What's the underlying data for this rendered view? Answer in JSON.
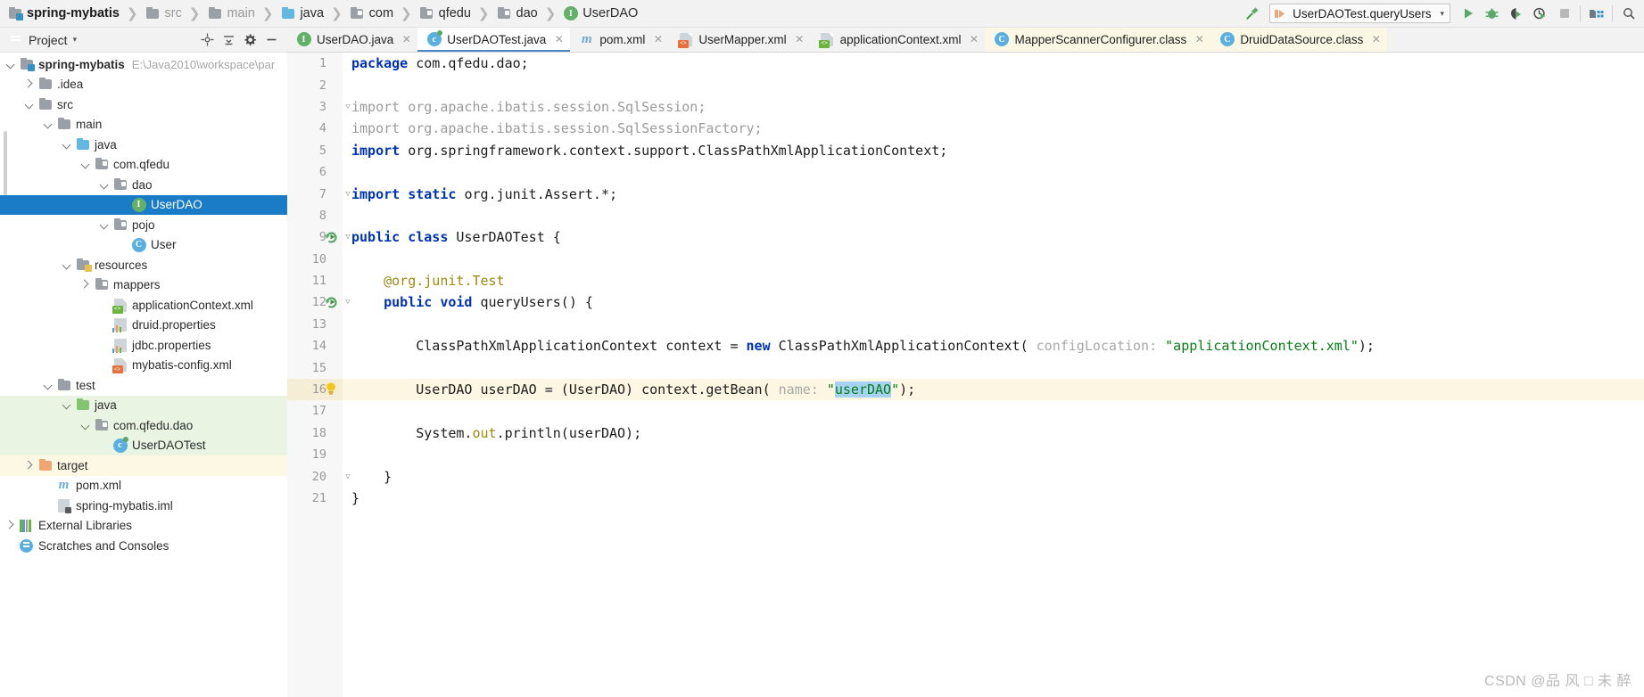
{
  "breadcrumb": [
    {
      "label": "spring-mybatis",
      "icon": "module-folder-icon",
      "style": "root"
    },
    {
      "label": "src",
      "icon": "folder-icon",
      "style": "dim"
    },
    {
      "label": "main",
      "icon": "folder-icon",
      "style": "dim"
    },
    {
      "label": "java",
      "icon": "source-folder-icon",
      "style": "normal"
    },
    {
      "label": "com",
      "icon": "package-folder-icon",
      "style": "normal"
    },
    {
      "label": "qfedu",
      "icon": "package-folder-icon",
      "style": "normal"
    },
    {
      "label": "dao",
      "icon": "package-folder-icon",
      "style": "normal"
    },
    {
      "label": "UserDAO",
      "icon": "interface-icon",
      "style": "normal"
    }
  ],
  "toolbar": {
    "hammer_icon": "build-hammer-icon",
    "run_configuration": "UserDAOTest.queryUsers",
    "run_config_icon": "junit-run-icon",
    "caret_icon": "chevron-down-icon",
    "buttons": [
      {
        "name": "run-button",
        "icon": "run-play-icon"
      },
      {
        "name": "debug-button",
        "icon": "debug-bug-icon"
      },
      {
        "name": "run-with-coverage-button",
        "icon": "coverage-shield-icon"
      },
      {
        "name": "profile-button",
        "icon": "profiler-clock-icon"
      },
      {
        "name": "stop-button",
        "icon": "stop-square-icon"
      },
      {
        "name": "project-structure-button",
        "icon": "project-structure-icon"
      }
    ]
  },
  "project_panel": {
    "title": "Project",
    "title_icon": "project-view-icon",
    "caret_icon": "chevron-down-icon",
    "actions": [
      {
        "name": "expand-collapse-button",
        "icon": "scroll-from-source-icon"
      },
      {
        "name": "collapse-all-button",
        "icon": "collapse-all-icon"
      },
      {
        "name": "settings-button",
        "icon": "gear-icon"
      },
      {
        "name": "hide-button",
        "icon": "minimize-icon"
      }
    ]
  },
  "tree": [
    {
      "label": "spring-mybatis",
      "path": "E:\\Java2010\\workspace\\par",
      "indent": 0,
      "arrow": "down",
      "icon": "module-folder-icon",
      "bold": true,
      "state": "normal"
    },
    {
      "label": ".idea",
      "indent": 1,
      "arrow": "right",
      "icon": "folder-icon",
      "state": "normal"
    },
    {
      "label": "src",
      "indent": 1,
      "arrow": "down",
      "icon": "folder-icon",
      "state": "normal"
    },
    {
      "label": "main",
      "indent": 2,
      "arrow": "down",
      "icon": "folder-icon",
      "state": "normal"
    },
    {
      "label": "java",
      "indent": 3,
      "arrow": "down",
      "icon": "source-folder-icon",
      "state": "normal"
    },
    {
      "label": "com.qfedu",
      "indent": 4,
      "arrow": "down",
      "icon": "package-folder-icon",
      "state": "normal"
    },
    {
      "label": "dao",
      "indent": 5,
      "arrow": "down",
      "icon": "package-folder-icon",
      "state": "normal"
    },
    {
      "label": "UserDAO",
      "indent": 6,
      "arrow": "none",
      "icon": "interface-icon",
      "state": "selected"
    },
    {
      "label": "pojo",
      "indent": 5,
      "arrow": "down",
      "icon": "package-folder-icon",
      "state": "normal"
    },
    {
      "label": "User",
      "indent": 6,
      "arrow": "none",
      "icon": "class-icon",
      "state": "normal"
    },
    {
      "label": "resources",
      "indent": 3,
      "arrow": "down",
      "icon": "resource-folder-icon",
      "state": "normal"
    },
    {
      "label": "mappers",
      "indent": 4,
      "arrow": "right",
      "icon": "package-folder-icon",
      "state": "normal"
    },
    {
      "label": "applicationContext.xml",
      "indent": 5,
      "arrow": "none",
      "icon": "spring-xml-icon",
      "state": "normal"
    },
    {
      "label": "druid.properties",
      "indent": 5,
      "arrow": "none",
      "icon": "properties-icon",
      "state": "normal"
    },
    {
      "label": "jdbc.properties",
      "indent": 5,
      "arrow": "none",
      "icon": "properties-icon",
      "state": "normal"
    },
    {
      "label": "mybatis-config.xml",
      "indent": 5,
      "arrow": "none",
      "icon": "mybatis-xml-icon",
      "state": "normal"
    },
    {
      "label": "test",
      "indent": 2,
      "arrow": "down",
      "icon": "folder-icon",
      "state": "normal"
    },
    {
      "label": "java",
      "indent": 3,
      "arrow": "down",
      "icon": "test-source-folder-icon",
      "state": "test-scope"
    },
    {
      "label": "com.qfedu.dao",
      "indent": 4,
      "arrow": "down",
      "icon": "package-folder-icon",
      "state": "test-scope"
    },
    {
      "label": "UserDAOTest",
      "indent": 5,
      "arrow": "none",
      "icon": "test-class-icon",
      "state": "test-scope"
    },
    {
      "label": "target",
      "indent": 1,
      "arrow": "right",
      "icon": "excluded-folder-icon",
      "state": "excluded"
    },
    {
      "label": "pom.xml",
      "indent": 2,
      "arrow": "none",
      "icon": "maven-icon",
      "state": "normal"
    },
    {
      "label": "spring-mybatis.iml",
      "indent": 2,
      "arrow": "none",
      "icon": "iml-module-icon",
      "state": "normal"
    },
    {
      "label": "External Libraries",
      "indent": 0,
      "arrow": "right",
      "icon": "external-libraries-icon",
      "state": "normal"
    },
    {
      "label": "Scratches and Consoles",
      "indent": 0,
      "arrow": "none",
      "icon": "scratches-icon",
      "state": "normal"
    }
  ],
  "tabs": [
    {
      "label": "UserDAO.java",
      "icon": "interface-icon",
      "active": false,
      "tinted": false
    },
    {
      "label": "UserDAOTest.java",
      "icon": "test-class-icon",
      "active": true,
      "tinted": false
    },
    {
      "label": "pom.xml",
      "icon": "maven-icon",
      "active": false,
      "tinted": false
    },
    {
      "label": "UserMapper.xml",
      "icon": "mybatis-xml-icon",
      "active": false,
      "tinted": false
    },
    {
      "label": "applicationContext.xml",
      "icon": "spring-xml-icon",
      "active": false,
      "tinted": false
    },
    {
      "label": "MapperScannerConfigurer.class",
      "icon": "class-icon",
      "active": false,
      "tinted": true
    },
    {
      "label": "DruidDataSource.class",
      "icon": "class-icon",
      "active": false,
      "tinted": true
    }
  ],
  "editor": {
    "file": "UserDAOTest.java",
    "current_line": 16,
    "selected_token": "userDAO",
    "lines": [
      {
        "n": 1,
        "segments": [
          {
            "t": "package ",
            "c": "kw"
          },
          {
            "t": "com.qfedu.dao;",
            "c": "pl"
          }
        ]
      },
      {
        "n": 2,
        "segments": []
      },
      {
        "n": 3,
        "fold": true,
        "segments": [
          {
            "t": "import ",
            "c": "kw-dim"
          },
          {
            "t": "org.apache.ibatis.session.SqlSession;",
            "c": "dim"
          }
        ]
      },
      {
        "n": 4,
        "segments": [
          {
            "t": "import ",
            "c": "kw-dim"
          },
          {
            "t": "org.apache.ibatis.session.SqlSessionFactory;",
            "c": "dim"
          }
        ]
      },
      {
        "n": 5,
        "segments": [
          {
            "t": "import ",
            "c": "kw"
          },
          {
            "t": "org.springframework.context.support.ClassPathXmlApplicationContext;",
            "c": "pl"
          }
        ]
      },
      {
        "n": 6,
        "segments": []
      },
      {
        "n": 7,
        "fold": true,
        "segments": [
          {
            "t": "import ",
            "c": "kw"
          },
          {
            "t": "static ",
            "c": "kw"
          },
          {
            "t": "org.junit.Assert.*;",
            "c": "pl"
          }
        ]
      },
      {
        "n": 8,
        "segments": []
      },
      {
        "n": 9,
        "gutter": "run-test-icon",
        "fold": true,
        "segments": [
          {
            "t": "public ",
            "c": "kw"
          },
          {
            "t": "class ",
            "c": "kw"
          },
          {
            "t": "UserDAOTest {",
            "c": "pl"
          }
        ]
      },
      {
        "n": 10,
        "segments": []
      },
      {
        "n": 11,
        "indent": 1,
        "segments": [
          {
            "t": "@org.junit.Test",
            "c": "anno"
          }
        ]
      },
      {
        "n": 12,
        "gutter": "run-test-icon",
        "fold": true,
        "indent": 1,
        "segments": [
          {
            "t": "public ",
            "c": "kw"
          },
          {
            "t": "void ",
            "c": "kw"
          },
          {
            "t": "queryUsers() {",
            "c": "pl"
          }
        ]
      },
      {
        "n": 13,
        "segments": []
      },
      {
        "n": 14,
        "indent": 2,
        "segments": [
          {
            "t": "ClassPathXmlApplicationContext context = ",
            "c": "pl"
          },
          {
            "t": "new ",
            "c": "kw"
          },
          {
            "t": "ClassPathXmlApplicationContext(",
            "c": "pl"
          },
          {
            "t": " configLocation: ",
            "c": "hint"
          },
          {
            "t": "\"applicationContext.xml\"",
            "c": "str"
          },
          {
            "t": ");",
            "c": "pl"
          }
        ]
      },
      {
        "n": 15,
        "segments": []
      },
      {
        "n": 16,
        "current": true,
        "gutter": "intention-bulb-icon",
        "indent": 2,
        "segments": [
          {
            "t": "UserDAO userDAO = (UserDAO) context.getBean(",
            "c": "pl"
          },
          {
            "t": " name: ",
            "c": "hint"
          },
          {
            "t": "\"",
            "c": "str"
          },
          {
            "t": "userDAO",
            "c": "str-sel"
          },
          {
            "t": "\"",
            "c": "str"
          },
          {
            "t": ");",
            "c": "pl"
          }
        ]
      },
      {
        "n": 17,
        "segments": []
      },
      {
        "n": 18,
        "indent": 2,
        "segments": [
          {
            "t": "System.",
            "c": "pl"
          },
          {
            "t": "out",
            "c": "field"
          },
          {
            "t": ".println(userDAO);",
            "c": "pl"
          }
        ]
      },
      {
        "n": 19,
        "segments": []
      },
      {
        "n": 20,
        "fold": true,
        "indent": 1,
        "segments": [
          {
            "t": "}",
            "c": "pl"
          }
        ]
      },
      {
        "n": 21,
        "segments": [
          {
            "t": "}",
            "c": "pl"
          }
        ]
      }
    ]
  },
  "watermark": "CSDN @品 风 □ 未 醉",
  "colors": {
    "selection_blue": "#1a7cc7",
    "test_scope_green": "#e9f5e2",
    "excluded_tan": "#fdf8e3",
    "current_line": "#fdf6e3",
    "keyword": "#0033b3",
    "string": "#067d17",
    "annotation": "#9e880d",
    "inline_hint": "#a8a8a8",
    "tab_active_underline": "#4a86c8"
  }
}
